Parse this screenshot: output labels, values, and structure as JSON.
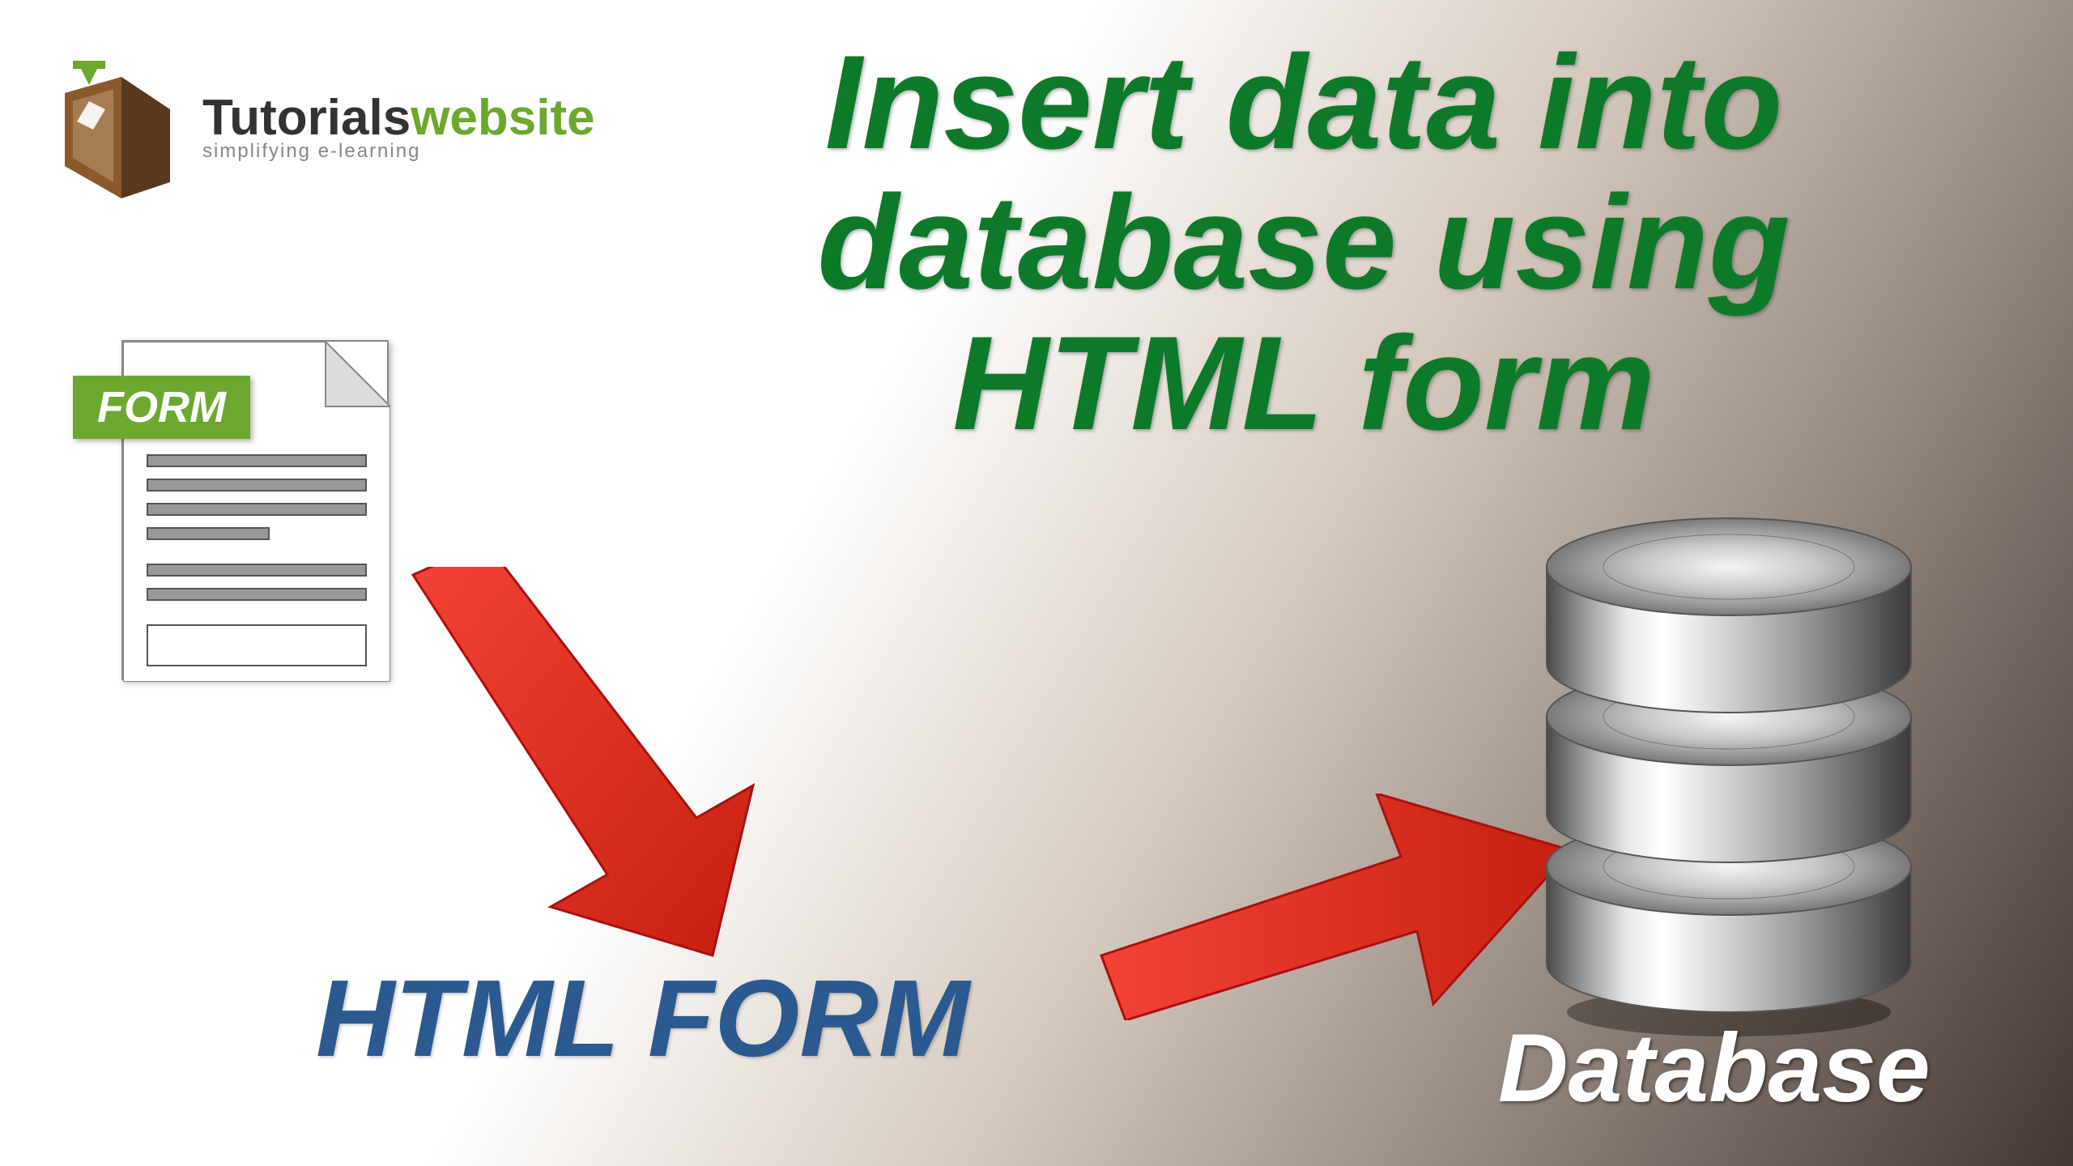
{
  "logo": {
    "title_prefix": "Tutorials",
    "title_suffix": "website",
    "subtitle": "simplifying e-learning"
  },
  "main_title": "Insert data into database using HTML  form",
  "form_label": "FORM",
  "html_form_label": "HTML FORM",
  "database_label": "Database",
  "colors": {
    "green": "#0d7a2a",
    "logo_green": "#6ca82d",
    "blue": "#2a5a8f",
    "red_arrow": "#e8362d"
  }
}
